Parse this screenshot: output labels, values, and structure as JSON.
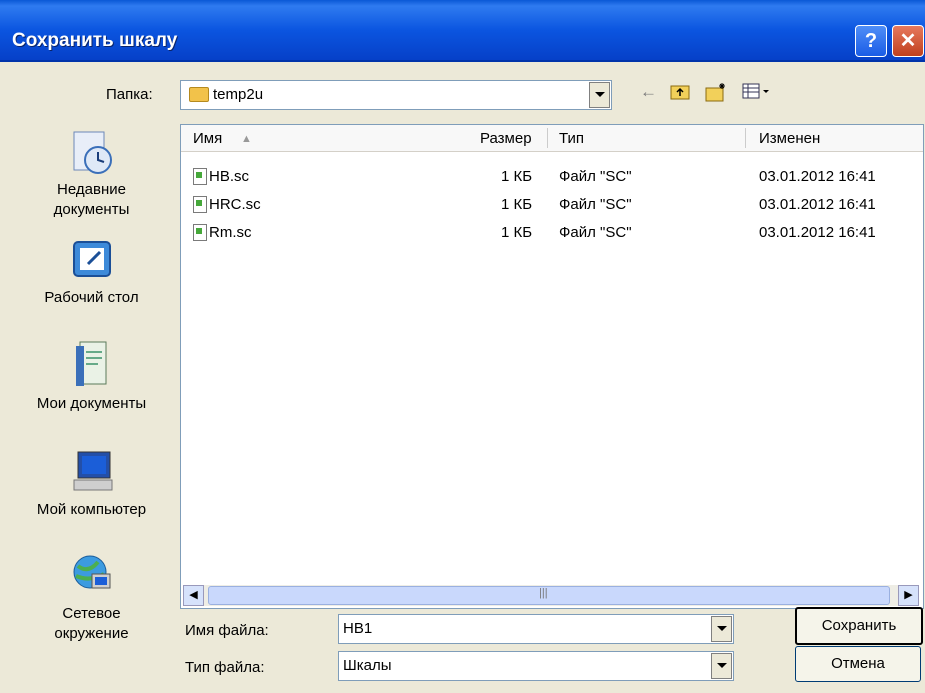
{
  "dialog": {
    "title": "Сохранить шкалу",
    "help_glyph": "?",
    "close_glyph": "✕"
  },
  "folder_bar": {
    "label": "Папка:",
    "value": "temp2u"
  },
  "places": [
    {
      "label_line1": "Недавние",
      "label_line2": "документы"
    },
    {
      "label_line1": "Рабочий стол",
      "label_line2": ""
    },
    {
      "label_line1": "Мои документы",
      "label_line2": ""
    },
    {
      "label_line1": "Мой компьютер",
      "label_line2": ""
    },
    {
      "label_line1": "Сетевое",
      "label_line2": "окружение"
    }
  ],
  "columns": {
    "name": "Имя",
    "size": "Размер",
    "type": "Тип",
    "modified": "Изменен"
  },
  "files": [
    {
      "name": "HB.sc",
      "size": "1 КБ",
      "type": "Файл \"SC\"",
      "modified": "03.01.2012 16:41"
    },
    {
      "name": "HRC.sc",
      "size": "1 КБ",
      "type": "Файл \"SC\"",
      "modified": "03.01.2012 16:41"
    },
    {
      "name": "Rm.sc",
      "size": "1 КБ",
      "type": "Файл \"SC\"",
      "modified": "03.01.2012 16:41"
    }
  ],
  "filename": {
    "label": "Имя файла:",
    "value": "HB1"
  },
  "filetype": {
    "label": "Тип файла:",
    "value": "Шкалы"
  },
  "buttons": {
    "save": "Сохранить",
    "cancel": "Отмена"
  },
  "icons": {
    "back": "back-arrow-icon",
    "up": "up-folder-icon",
    "new_folder": "new-folder-icon",
    "views": "views-menu-icon"
  }
}
